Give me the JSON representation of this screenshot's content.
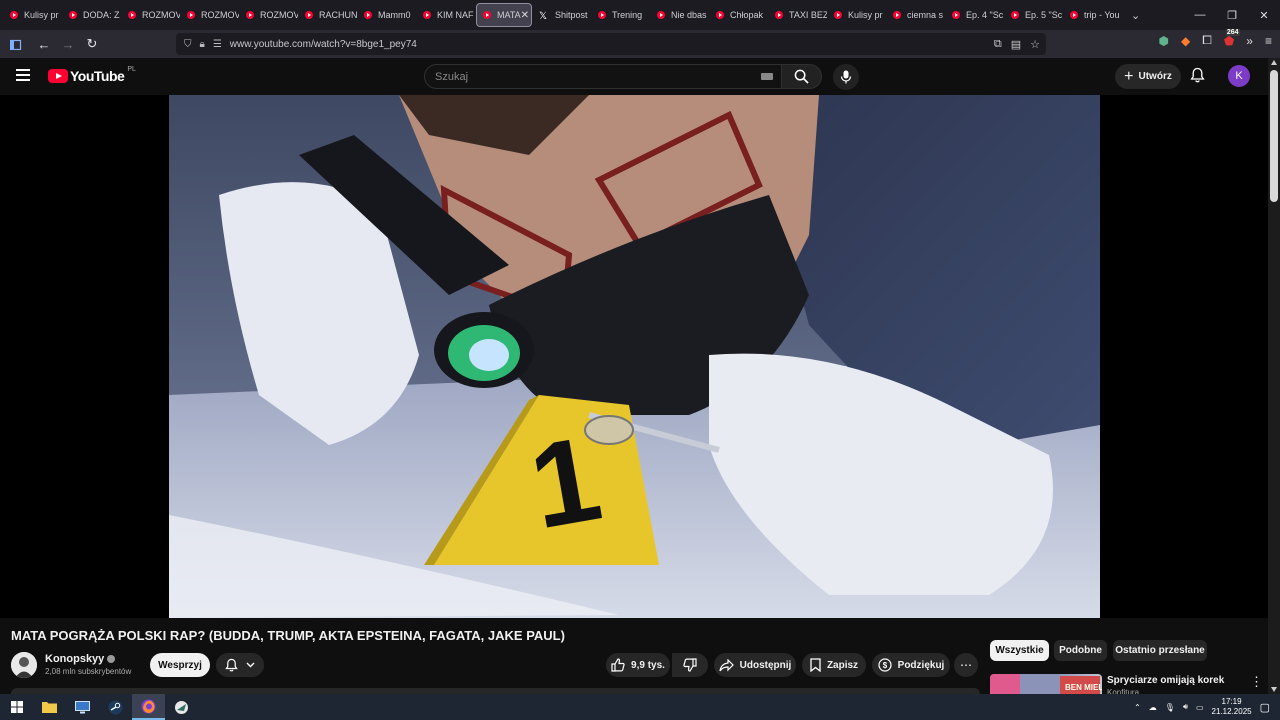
{
  "browser": {
    "tabs": [
      {
        "label": "Kulisy pr",
        "icon": "youtube-favicon"
      },
      {
        "label": "DODA: Z",
        "icon": "youtube-favicon"
      },
      {
        "label": "ROZMOV",
        "icon": "youtube-favicon"
      },
      {
        "label": "ROZMOV",
        "icon": "youtube-favicon"
      },
      {
        "label": "ROZMOV",
        "icon": "youtube-favicon"
      },
      {
        "label": "RACHUN",
        "icon": "youtube-favicon"
      },
      {
        "label": "Mamm0",
        "icon": "youtube-favicon"
      },
      {
        "label": "KIM NAF",
        "icon": "youtube-favicon"
      },
      {
        "label": "MATA",
        "icon": "youtube-favicon",
        "active": true
      },
      {
        "label": "Shitpost",
        "icon": "x-favicon"
      },
      {
        "label": "Trening",
        "icon": "youtube-favicon"
      },
      {
        "label": "Nie dbas",
        "icon": "youtube-favicon"
      },
      {
        "label": "Chłopak",
        "icon": "youtube-favicon"
      },
      {
        "label": "TAXI BEZ",
        "icon": "youtube-favicon"
      },
      {
        "label": "Kulisy pr",
        "icon": "youtube-favicon"
      },
      {
        "label": "ciemna s",
        "icon": "youtube-favicon"
      },
      {
        "label": "Ep. 4 \"Sc",
        "icon": "youtube-favicon"
      },
      {
        "label": "Ep. 5 \"Sc",
        "icon": "youtube-favicon"
      },
      {
        "label": "trip - You",
        "icon": "youtube-favicon"
      }
    ],
    "url": "www.youtube.com/watch?v=8bge1_pey74",
    "extension_badge": "264"
  },
  "youtube": {
    "logo_text": "YouTube",
    "country_code": "PL",
    "search_placeholder": "Szukaj",
    "create_label": "Utwórz",
    "avatar_letter": "K"
  },
  "video": {
    "title": "MATA POGRĄŻA POLSKI RAP? (BUDDA, TRUMP, AKTA EPSTEINA, FAGATA, JAKE PAUL)",
    "channel": "Konopskyy",
    "subscribers": "2,08 mln subskrybentów",
    "support_label": "Wesprzyj",
    "likes": "9,9 tys.",
    "share_label": "Udostępnij",
    "save_label": "Zapisz",
    "thanks_label": "Podziękuj",
    "evidence_marker": "1"
  },
  "chips": [
    "Wszystkie",
    "Podobne",
    "Ostatnio przesłane"
  ],
  "recommendation": {
    "title": "Spryciarze omijają korek",
    "channel": "Konfitura"
  },
  "taskbar": {
    "time": "17:19",
    "date": "21.12.2025"
  },
  "colors": {
    "yt_red": "#ff0033",
    "background": "#0f0f0f",
    "avatar": "#7d3cc8",
    "taskbar": "#1f2633"
  }
}
